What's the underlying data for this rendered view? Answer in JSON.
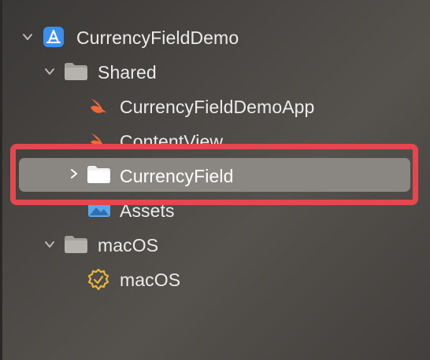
{
  "tree": {
    "items": [
      {
        "label": "CurrencyFieldDemo",
        "icon": "xcode-project-icon",
        "expanded": true
      },
      {
        "label": "Shared",
        "icon": "folder-icon",
        "expanded": true
      },
      {
        "label": "CurrencyFieldDemoApp",
        "icon": "swift-icon"
      },
      {
        "label": "ContentView",
        "icon": "swift-icon"
      },
      {
        "label": "CurrencyField",
        "icon": "folder-icon",
        "expanded": false,
        "selected": true
      },
      {
        "label": "Assets",
        "icon": "asset-catalog-icon"
      },
      {
        "label": "macOS",
        "icon": "folder-icon",
        "expanded": true
      },
      {
        "label": "macOS",
        "icon": "entitlements-badge-icon"
      }
    ]
  },
  "colors": {
    "selection": "#8a8783",
    "annotation": "#e5474f",
    "swift": "#f26a3a",
    "project": "#3b8df0",
    "badge": "#e9b73b"
  }
}
